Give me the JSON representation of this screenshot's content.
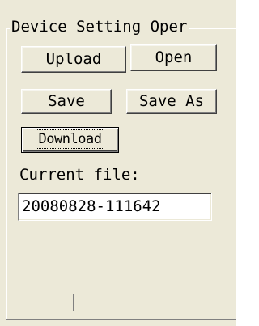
{
  "group": {
    "title": "Device Setting Oper"
  },
  "buttons": {
    "upload": "Upload",
    "open": "Open",
    "save": "Save",
    "save_as": "Save As",
    "download": "Download"
  },
  "current_file": {
    "label": "Current file:",
    "value": "20080828-111642"
  },
  "icons": {
    "crosshair": "crosshair-icon"
  }
}
